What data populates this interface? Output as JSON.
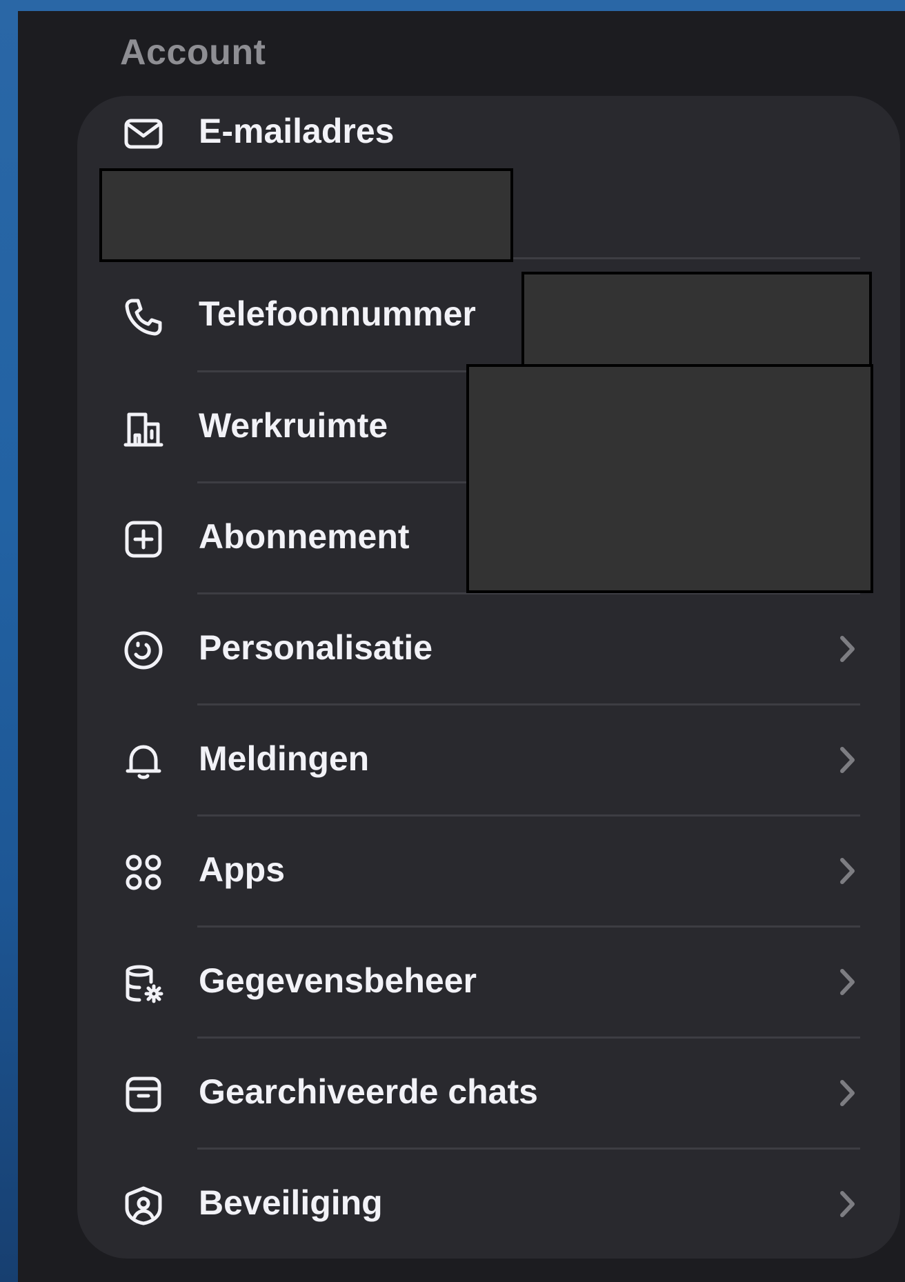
{
  "section": {
    "title": "Account"
  },
  "rows": [
    {
      "label": "E-mailadres",
      "icon": "mail-icon",
      "chevron": false
    },
    {
      "label": "Telefoonnummer",
      "icon": "phone-icon",
      "chevron": false
    },
    {
      "label": "Werkruimte",
      "icon": "building-icon",
      "chevron": false
    },
    {
      "label": "Abonnement",
      "icon": "plus-square-icon",
      "chevron": false
    },
    {
      "label": "Personalisatie",
      "icon": "smiley-icon",
      "chevron": true
    },
    {
      "label": "Meldingen",
      "icon": "bell-icon",
      "chevron": true
    },
    {
      "label": "Apps",
      "icon": "apps-grid-icon",
      "chevron": true
    },
    {
      "label": "Gegevensbeheer",
      "icon": "database-gear-icon",
      "chevron": true
    },
    {
      "label": "Gearchiveerde chats",
      "icon": "archive-box-icon",
      "chevron": true
    },
    {
      "label": "Beveiliging",
      "icon": "shield-user-icon",
      "chevron": true
    }
  ],
  "colors": {
    "screen_background": "#1c1c20",
    "card_background": "#29292e",
    "label_text": "#f2f2f7",
    "section_title": "#8e8e93",
    "chevron": "#7d7d82",
    "redaction": "#333333"
  }
}
